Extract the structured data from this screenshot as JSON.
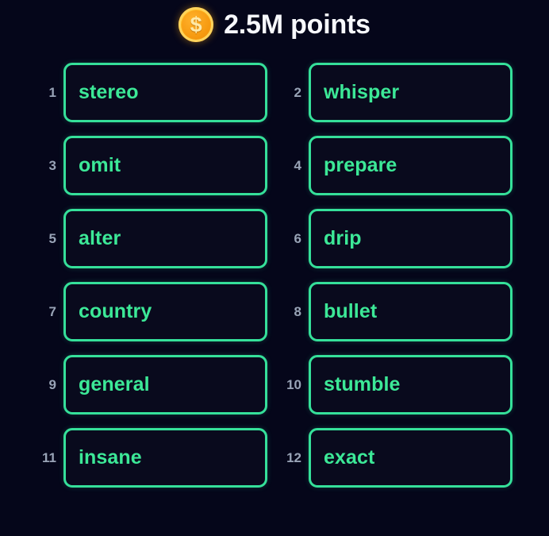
{
  "header": {
    "coin_icon": "coin-dollar-icon",
    "coin_glyph": "$",
    "points_label": "2.5M points",
    "points_value": "2.5M",
    "points_unit": "points"
  },
  "colors": {
    "background": "#05061a",
    "box_background": "#090a1d",
    "border_green": "#35e09a",
    "word_green": "#3ce897",
    "index_grey": "#98a3b6",
    "title_white": "#f7f8fc",
    "coin_gold": "#f79c12"
  },
  "word_list": {
    "columns": 2,
    "count": 12,
    "items": [
      {
        "index": "1",
        "word": "stereo"
      },
      {
        "index": "2",
        "word": "whisper"
      },
      {
        "index": "3",
        "word": "omit"
      },
      {
        "index": "4",
        "word": "prepare"
      },
      {
        "index": "5",
        "word": "alter"
      },
      {
        "index": "6",
        "word": "drip"
      },
      {
        "index": "7",
        "word": "country"
      },
      {
        "index": "8",
        "word": "bullet"
      },
      {
        "index": "9",
        "word": "general"
      },
      {
        "index": "10",
        "word": "stumble"
      },
      {
        "index": "11",
        "word": "insane"
      },
      {
        "index": "12",
        "word": "exact"
      }
    ]
  }
}
